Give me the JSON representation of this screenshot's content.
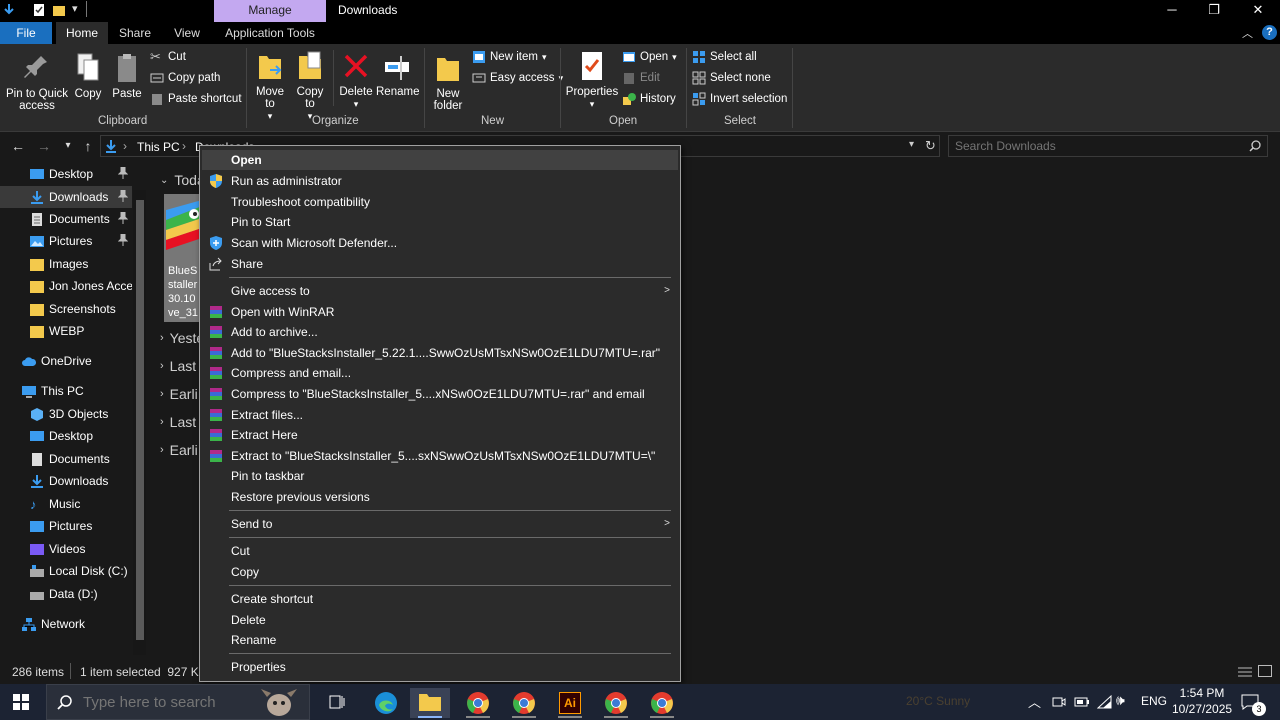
{
  "window": {
    "manage_tab": "Manage",
    "title": "Downloads"
  },
  "tabs": {
    "file": "File",
    "home": "Home",
    "share": "Share",
    "view": "View",
    "app_tools": "Application Tools"
  },
  "ribbon": {
    "clipboard": {
      "label": "Clipboard",
      "pin": "Pin to Quick access",
      "copy": "Copy",
      "paste": "Paste",
      "cut": "Cut",
      "copy_path": "Copy path",
      "paste_shortcut": "Paste shortcut"
    },
    "organize": {
      "label": "Organize",
      "move_to": "Move to",
      "copy_to": "Copy to",
      "delete": "Delete",
      "rename": "Rename"
    },
    "new": {
      "label": "New",
      "new_folder": "New folder",
      "new_item": "New item",
      "easy_access": "Easy access"
    },
    "open": {
      "label": "Open",
      "properties": "Properties",
      "open": "Open",
      "edit": "Edit",
      "history": "History"
    },
    "select": {
      "label": "Select",
      "select_all": "Select all",
      "select_none": "Select none",
      "invert": "Invert selection"
    }
  },
  "address": {
    "this_pc": "This PC",
    "downloads": "Downloads",
    "search_placeholder": "Search Downloads"
  },
  "nav": {
    "quick": [
      {
        "label": "Desktop",
        "pinned": true
      },
      {
        "label": "Downloads",
        "pinned": true
      },
      {
        "label": "Documents",
        "pinned": true
      },
      {
        "label": "Pictures",
        "pinned": true
      },
      {
        "label": "Images",
        "pinned": false
      },
      {
        "label": "Jon Jones Accep",
        "pinned": false
      },
      {
        "label": "Screenshots",
        "pinned": false
      },
      {
        "label": "WEBP",
        "pinned": false
      }
    ],
    "onedrive": "OneDrive",
    "this_pc": "This PC",
    "pc_items": [
      "3D Objects",
      "Desktop",
      "Documents",
      "Downloads",
      "Music",
      "Pictures",
      "Videos",
      "Local Disk (C:)",
      "Data (D:)"
    ],
    "network": "Network"
  },
  "content": {
    "groups": [
      "Toda",
      "Yeste",
      "Last",
      "Earli",
      "Last",
      "Earli"
    ],
    "file_name": "BlueS\nstaller\n30.10\nve_31"
  },
  "status": {
    "items": "286 items",
    "selected": "1 item selected  927 KB"
  },
  "menu": {
    "open": "Open",
    "run_admin": "Run as administrator",
    "troubleshoot": "Troubleshoot compatibility",
    "pin_start": "Pin to Start",
    "scan": "Scan with Microsoft Defender...",
    "share": "Share",
    "give_access": "Give access to",
    "open_winrar": "Open with WinRAR",
    "add_archive": "Add to archive...",
    "add_to_rar": "Add to \"BlueStacksInstaller_5.22.1....SwwOzUsMTsxNSw0OzE1LDU7MTU=.rar\"",
    "compress_email": "Compress and email...",
    "compress_to_rar": "Compress to \"BlueStacksInstaller_5....xNSw0OzE1LDU7MTU=.rar\" and email",
    "extract_files": "Extract files...",
    "extract_here": "Extract Here",
    "extract_to": "Extract to \"BlueStacksInstaller_5....sxNSwwOzUsMTsxNSw0OzE1LDU7MTU=\\\"",
    "pin_taskbar": "Pin to taskbar",
    "restore": "Restore previous versions",
    "send_to": "Send to",
    "cut": "Cut",
    "copy": "Copy",
    "create_shortcut": "Create shortcut",
    "delete": "Delete",
    "rename": "Rename",
    "properties": "Properties"
  },
  "taskbar": {
    "search_placeholder": "Type here to search",
    "weather": "20°C  Sunny",
    "lang": "ENG",
    "time": "1:54 PM",
    "date": "10/27/2025",
    "notifications": "3"
  },
  "colors": {
    "accent_blue": "#1a6fbf",
    "manage_purple": "#c3a8f0",
    "folder_yellow": "#f3c94c"
  }
}
